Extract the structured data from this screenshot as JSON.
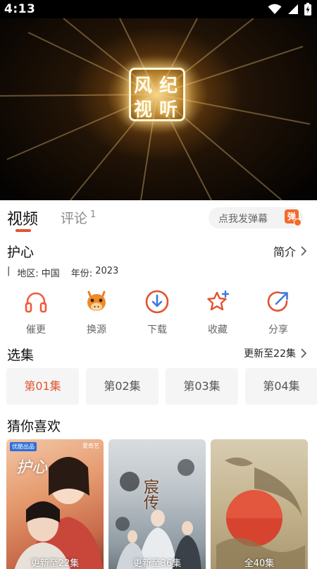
{
  "status": {
    "time": "4:13"
  },
  "tabs": {
    "video": "视频",
    "comment": "评论",
    "comment_count": "1"
  },
  "danmaku": {
    "placeholder": "点我发弹幕",
    "badge": "弹"
  },
  "show": {
    "title": "护心",
    "intro_label": "简介",
    "meta_bar": "|",
    "region_label": "地区:",
    "region": "中国",
    "year_label": "年份:",
    "year": "2023"
  },
  "actions": [
    {
      "label": "催更",
      "icon": "headphones-icon"
    },
    {
      "label": "换源",
      "icon": "camel-icon"
    },
    {
      "label": "下载",
      "icon": "download-icon"
    },
    {
      "label": "收藏",
      "icon": "star-icon"
    },
    {
      "label": "分享",
      "icon": "share-icon"
    }
  ],
  "episodes": {
    "title": "选集",
    "update_label": "更新至22集",
    "items": [
      "第01集",
      "第02集",
      "第03集",
      "第04集"
    ],
    "active_index": 0
  },
  "recommend": {
    "title": "猜你喜欢",
    "items": [
      {
        "caption": "更新至22集",
        "poster_title": "护心",
        "tag_left": "优酷出品",
        "tag_right": "爱奇艺"
      },
      {
        "caption": "更新至36集",
        "poster_title": "宸传"
      },
      {
        "caption": "全40集"
      }
    ]
  },
  "colors": {
    "accent": "#e4522f",
    "danmaku_badge": "#f26b2c"
  }
}
